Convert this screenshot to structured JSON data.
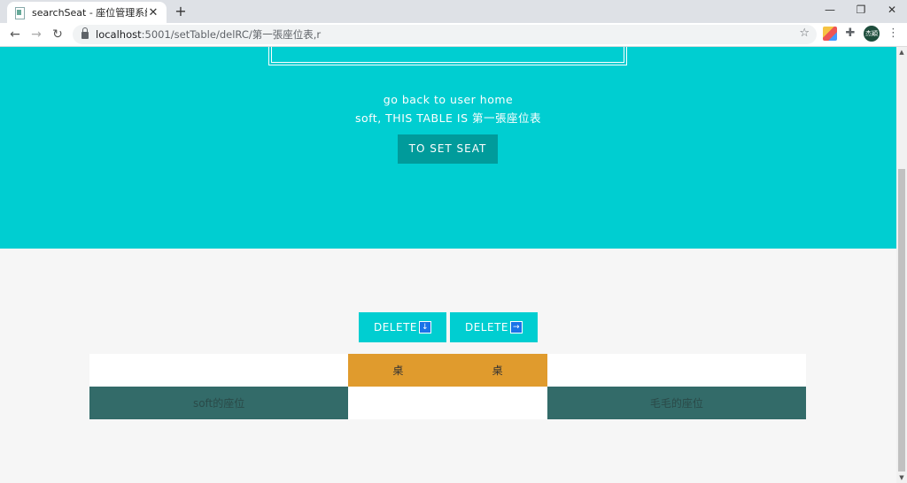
{
  "browser": {
    "tab_title": "searchSeat - 座位管理系統",
    "tab_close": "✕",
    "new_tab": "+",
    "minimize": "—",
    "restore": "❐",
    "close": "✕",
    "back": "←",
    "forward": "→",
    "reload": "↻",
    "url_host": "localhost",
    "url_path": ":5001/setTable/delRC/第一張座位表,r",
    "star": "☆",
    "profile_text": "杰穎",
    "menu": "⋮"
  },
  "hero": {
    "link_text": "go back to user home",
    "title": "soft, THIS TABLE IS 第一張座位表",
    "set_seat_label": "TO SET SEAT"
  },
  "actions": {
    "delete_down_label": "DELETE",
    "delete_down_arrow": "↓",
    "delete_right_label": "DELETE",
    "delete_right_arrow": "→"
  },
  "seat_table": {
    "desk_left": "桌",
    "desk_right": "桌",
    "seat_left": "soft的座位",
    "seat_right": "毛毛的座位"
  },
  "colors": {
    "hero_bg": "#00ced1",
    "button_dark": "#009b9b",
    "desk": "#e09b2d",
    "seat": "#336b69"
  },
  "icons": [
    "document-icon",
    "close-icon",
    "plus-icon",
    "minimize-icon",
    "restore-icon",
    "back-arrow-icon",
    "forward-arrow-icon",
    "reload-icon",
    "lock-icon",
    "star-icon",
    "extension-icon",
    "puzzle-icon",
    "more-menu-icon",
    "arrow-down-icon",
    "arrow-right-icon"
  ]
}
